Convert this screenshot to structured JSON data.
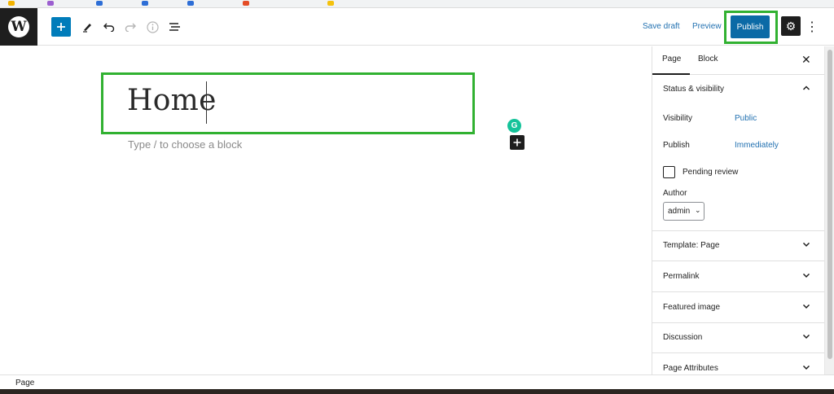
{
  "toolbar": {
    "save_draft": "Save draft",
    "preview": "Preview",
    "publish": "Publish"
  },
  "editor": {
    "title": "Home",
    "block_placeholder": "Type / to choose a block"
  },
  "sidebar": {
    "tabs": [
      "Page",
      "Block"
    ],
    "status_visibility": {
      "heading": "Status & visibility",
      "visibility_label": "Visibility",
      "visibility_value": "Public",
      "publish_label": "Publish",
      "publish_value": "Immediately",
      "pending_review": "Pending review",
      "author_label": "Author",
      "author_value": "admin"
    },
    "panels": [
      "Template: Page",
      "Permalink",
      "Featured image",
      "Discussion",
      "Page Attributes"
    ]
  },
  "footer": {
    "breadcrumb": "Page"
  },
  "colors": {
    "accent": "#007cba",
    "publish": "#0b6aa6",
    "highlight": "#31b131",
    "link": "#2271b1"
  }
}
